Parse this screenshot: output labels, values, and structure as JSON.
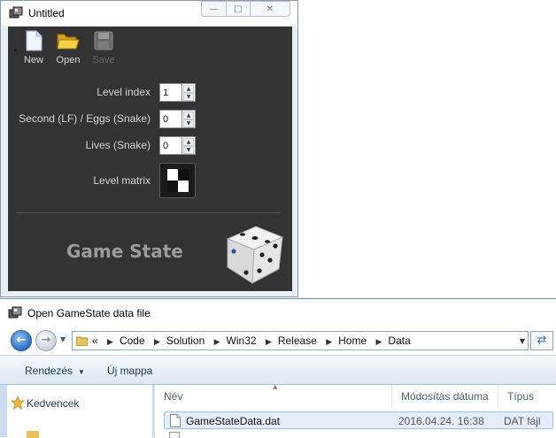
{
  "app": {
    "title": "Untitled",
    "toolbar": [
      {
        "label": "New",
        "icon": "new-document-icon",
        "enabled": true
      },
      {
        "label": "Open",
        "icon": "open-folder-icon",
        "enabled": true
      },
      {
        "label": "Save",
        "icon": "save-floppy-icon",
        "enabled": false
      }
    ],
    "fields": {
      "level_index": {
        "label": "Level index",
        "value": "1"
      },
      "second_eggs": {
        "label": "Second (LF) / Eggs (Snake)",
        "value": "0"
      },
      "lives": {
        "label": "Lives (Snake)",
        "value": "0"
      },
      "level_matrix": {
        "label": "Level matrix"
      }
    },
    "logo_text": "Game State",
    "colors": {
      "body_bg": "#333333",
      "label": "#d6d6d6",
      "logo": "#9b9b9b"
    }
  },
  "dialog": {
    "title": "Open GameState data file",
    "breadcrumb_prefix": "«",
    "breadcrumbs": [
      "Code",
      "Solution",
      "Win32",
      "Release",
      "Home",
      "Data"
    ],
    "commands": {
      "organize": "Rendezés",
      "new_folder": "Új mappa"
    },
    "nav": {
      "favorites": "Kedvencek"
    },
    "columns": {
      "name": "Név",
      "modified": "Módosítás dátuma",
      "type": "Típus"
    },
    "files": [
      {
        "name": "GameStateData.dat",
        "modified": "2016.04.24. 16:38",
        "type": "DAT fájl",
        "selected": true
      }
    ],
    "colors": {
      "chrome": "#c9dcef",
      "selection": "#e3eefa",
      "selection_border": "#9fc0e6"
    }
  }
}
